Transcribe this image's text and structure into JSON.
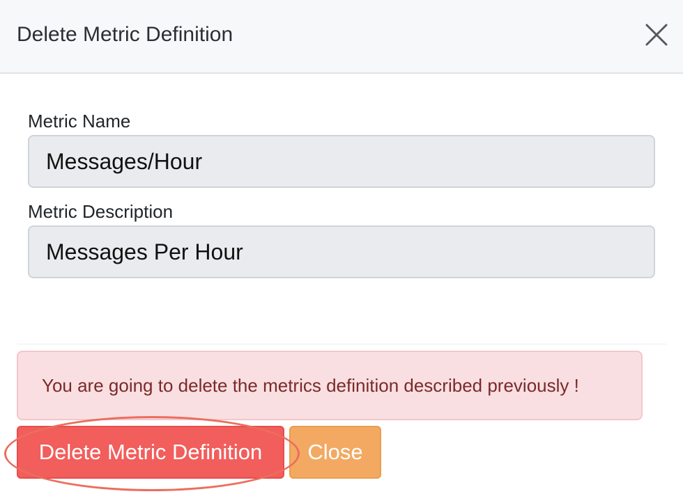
{
  "dialog": {
    "title": "Delete Metric Definition"
  },
  "form": {
    "metric_name": {
      "label": "Metric Name",
      "value": "Messages/Hour"
    },
    "metric_description": {
      "label": "Metric Description",
      "value": "Messages Per Hour"
    }
  },
  "alert": {
    "message": "You are going to delete the metrics definition described previously !"
  },
  "buttons": {
    "delete_label": "Delete Metric Definition",
    "close_label": "Close"
  },
  "icons": {
    "close": "close-icon"
  },
  "colors": {
    "delete_button": "#f15e5c",
    "close_button": "#f3a962",
    "alert_background": "#f9dfe1",
    "alert_text": "#7a2a2a",
    "highlight_ring": "#ea6e5e"
  }
}
